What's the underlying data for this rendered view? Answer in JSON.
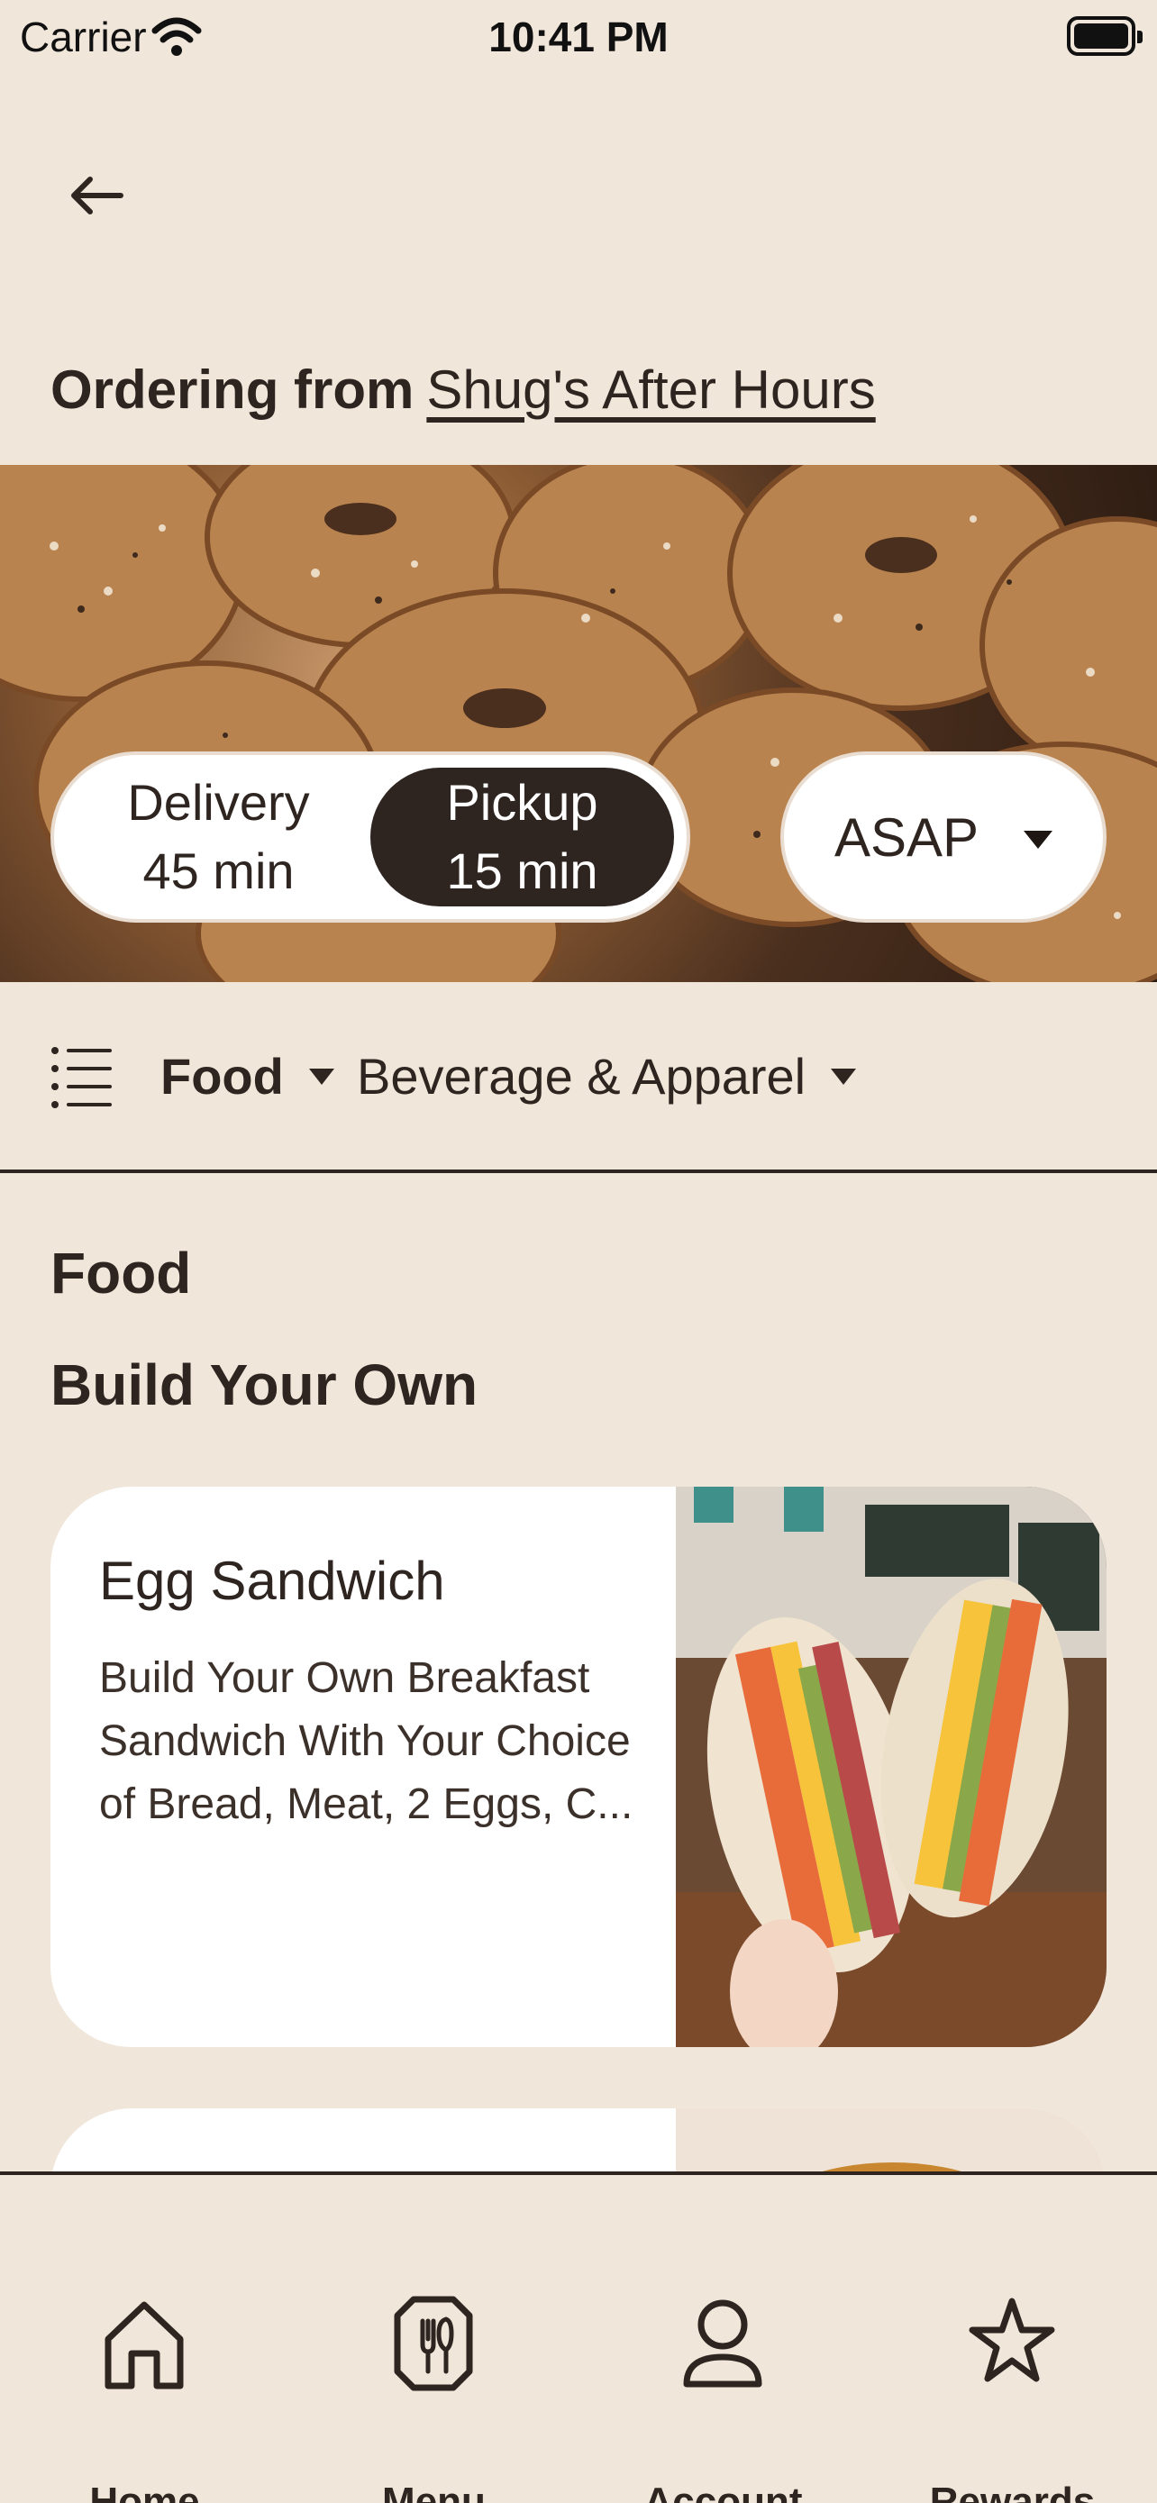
{
  "status_bar": {
    "carrier": "Carrier",
    "time": "10:41 PM"
  },
  "header": {
    "ordering_label": "Ordering from",
    "store_name": "Shug's After Hours"
  },
  "order_mode": {
    "delivery": {
      "label": "Delivery",
      "time": "45 min"
    },
    "pickup": {
      "label": "Pickup",
      "time": "15 min",
      "selected": true
    },
    "timing": "ASAP"
  },
  "categories": [
    {
      "label": "Food",
      "active": true
    },
    {
      "label": "Beverage & Apparel",
      "active": false
    }
  ],
  "menu": {
    "section": "Food",
    "subsection": "Build Your Own",
    "items": [
      {
        "name": "Egg Sandwich",
        "description": "Build Your Own Breakfast Sandwich With Your Choice of Bread, Meat, 2 Eggs, C..."
      }
    ]
  },
  "bottom_nav": [
    {
      "label": "Home",
      "icon": "home-icon"
    },
    {
      "label": "Menu",
      "icon": "menu-utensils-icon"
    },
    {
      "label": "Account",
      "icon": "account-icon"
    },
    {
      "label": "Rewards",
      "icon": "star-icon"
    }
  ],
  "colors": {
    "background": "#f1e6da",
    "primary": "#2e2420",
    "surface": "#ffffff"
  }
}
